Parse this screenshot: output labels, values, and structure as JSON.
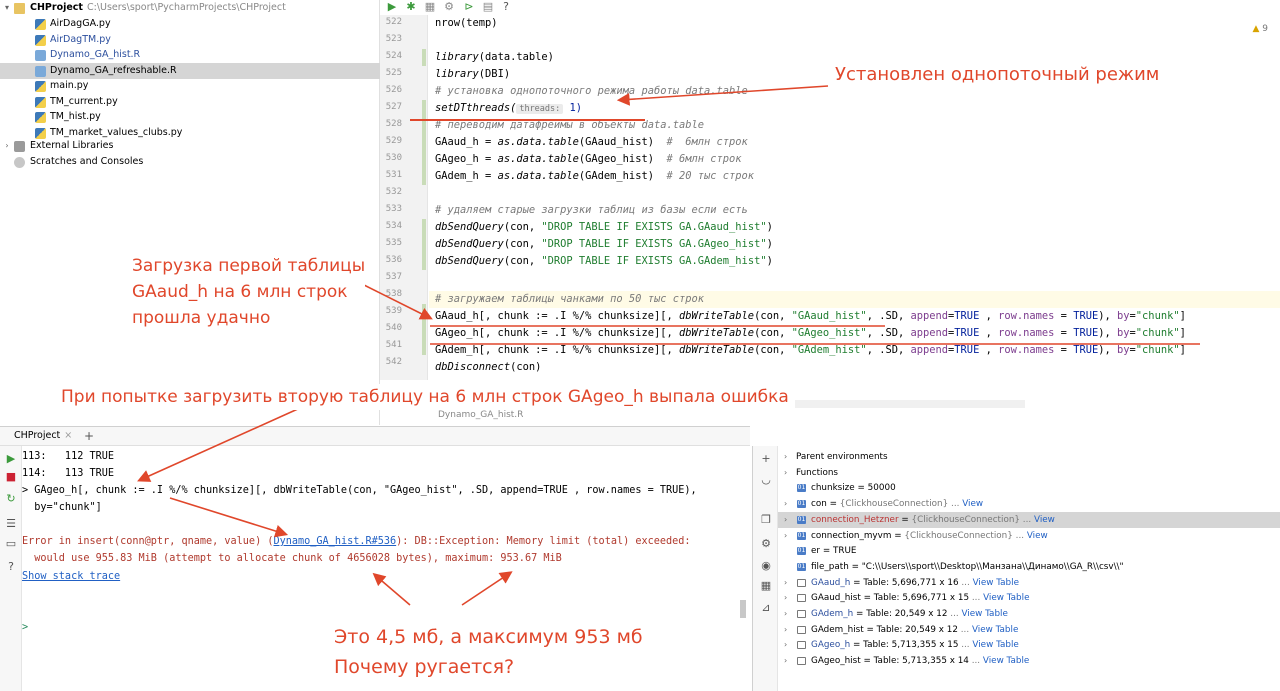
{
  "project_tree": {
    "root_name": "CHProject",
    "root_path": "C:\\Users\\sport\\PycharmProjects\\CHProject",
    "files": [
      {
        "name": "AirDagGA.py",
        "type": "py",
        "color": "#000000"
      },
      {
        "name": "AirDagTM.py",
        "type": "py",
        "color": "#2c4f9e"
      },
      {
        "name": "Dynamo_GA_hist.R",
        "type": "r",
        "color": "#2c4f9e"
      },
      {
        "name": "Dynamo_GA_refreshable.R",
        "type": "r",
        "color": "#000000"
      },
      {
        "name": "main.py",
        "type": "py",
        "color": "#000000"
      },
      {
        "name": "TM_current.py",
        "type": "py",
        "color": "#000000"
      },
      {
        "name": "TM_hist.py",
        "type": "py",
        "color": "#000000"
      },
      {
        "name": "TM_market_values_clubs.py",
        "type": "py",
        "color": "#000000"
      }
    ],
    "external_libraries": "External Libraries",
    "scratches": "Scratches and Consoles"
  },
  "editor": {
    "line_numbers": [
      "522",
      "523",
      "524",
      "525",
      "526",
      "527",
      "528",
      "529",
      "530",
      "531",
      "532",
      "533",
      "534",
      "535",
      "536",
      "537",
      "538",
      "539",
      "540",
      "541",
      "542"
    ],
    "warning_count": "9",
    "tab_label": "Dynamo_GA_hist.R",
    "param_hint": "threads:",
    "lines": {
      "l522": "nrow(temp)",
      "l524a": "library",
      "l524b": "(data.table)",
      "l525a": "library",
      "l525b": "(DBI)",
      "l526": "# установка однопоточного режима работы data.table",
      "l527a": "setDTthreads(",
      "l527b": "1)",
      "l528": "# переводим датафреймы в объекты data.table",
      "l529a": "GAaud_h = ",
      "l529b": "as.data.table",
      "l529c": "(GAaud_hist)  ",
      "l529d": "#  6млн строк",
      "l530a": "GAgeo_h = ",
      "l530b": "as.data.table",
      "l530c": "(GAgeo_hist)  ",
      "l530d": "# 6млн строк",
      "l531a": "GAdem_h = ",
      "l531b": "as.data.table",
      "l531c": "(GAdem_hist)  ",
      "l531d": "# 20 тыс строк",
      "l533": "# удаляем старые загрузки таблиц из базы если есть",
      "l534a": "dbSendQuery",
      "l534b": "(con, ",
      "l534c": "\"DROP TABLE IF EXISTS GA.GAaud_hist\"",
      "l534d": ")",
      "l535a": "dbSendQuery",
      "l535b": "(con, ",
      "l535c": "\"DROP TABLE IF EXISTS GA.GAgeo_hist\"",
      "l535d": ")",
      "l536a": "dbSendQuery",
      "l536b": "(con, ",
      "l536c": "\"DROP TABLE IF EXISTS GA.GAdem_hist\"",
      "l536d": ")",
      "l538": "# загружаем таблицы чанками по 50 тыс строк",
      "l539a": "GAaud_h[, chunk := .I %/% chunksize][, ",
      "l539b": "dbWriteTable",
      "l539c": "(con, ",
      "l539d": "\"GAaud_hist\"",
      "l539e": ", .SD, ",
      "l539f": "append",
      "l539g": "=",
      "l539h": "TRUE",
      "l539i": " , ",
      "l539j": "row.names",
      "l539k": " = ",
      "l539l": "TRUE",
      "l539m": "), ",
      "l539n": "by",
      "l539o": "=",
      "l539p": "\"chunk\"",
      "l539q": "]",
      "l540a": "GAgeo_h[, chunk := .I %/% chunksize][, ",
      "l540b": "dbWriteTable",
      "l540c": "(con, ",
      "l540d": "\"GAgeo_hist\"",
      "l540e": ", .SD, ",
      "l540f": "append",
      "l540g": "=",
      "l540h": "TRUE",
      "l540i": " , ",
      "l540j": "row.names",
      "l540k": " = ",
      "l540l": "TRUE",
      "l540m": "), ",
      "l540n": "by",
      "l540o": "=",
      "l540p": "\"chunk\"",
      "l540q": "]",
      "l541a": "GAdem_h[, chunk := .I %/% chunksize][, ",
      "l541b": "dbWriteTable",
      "l541c": "(con, ",
      "l541d": "\"GAdem_hist\"",
      "l541e": ", .SD, ",
      "l541f": "append",
      "l541g": "=",
      "l541h": "TRUE",
      "l541i": " , ",
      "l541j": "row.names",
      "l541k": " = ",
      "l541l": "TRUE",
      "l541m": "), ",
      "l541n": "by",
      "l541o": "=",
      "l541p": "\"chunk\"",
      "l541q": "]",
      "l542a": "dbDisconnect",
      "l542b": "(con)"
    }
  },
  "annotations": {
    "single_thread": "Установлен однопоточный режим",
    "first_table_1": "Загрузка первой таблицы",
    "first_table_2": "GAaud_h на 6 млн строк",
    "first_table_3": "прошла удачно",
    "second_table_error": "При попытке загрузить вторую таблицу на 6 млн строк GAgeo_h выпала ошибка",
    "question_1": "Это 4,5 мб,  а максимум 953 мб",
    "question_2": "Почему ругается?"
  },
  "console": {
    "tab_label": "CHProject",
    "lines": {
      "c1": "113:   112 TRUE",
      "c2": "114:   113 TRUE",
      "c3": "> GAgeo_h[, chunk := .I %/% chunksize][, dbWriteTable(con, \"GAgeo_hist\", .SD, append=TRUE , row.names = TRUE),",
      "c4": "  by=\"chunk\"]",
      "c5a": "Error in insert(conn@ptr, qname, value) (",
      "c5b": "Dynamo_GA_hist.R#536",
      "c5c": "): DB::Exception: Memory limit (total) exceeded:",
      "c6": "  would use 955.83 MiB (attempt to allocate chunk of 4656028 bytes), maximum: 953.67 MiB",
      "c7": "Show stack trace",
      "c8": ">"
    }
  },
  "variables": [
    {
      "kind": "group",
      "text": "Parent environments"
    },
    {
      "kind": "group",
      "text": "Functions"
    },
    {
      "kind": "value",
      "name": "chunksize",
      "value": " = 50000",
      "type": "",
      "view": ""
    },
    {
      "kind": "obj",
      "name": "con",
      "value": " = ",
      "type": "{ClickhouseConnection}",
      "view": "View"
    },
    {
      "kind": "obj",
      "name": "connection_Hetzner",
      "value": " = ",
      "type": "{ClickhouseConnection}",
      "view": "View",
      "selected": true,
      "red": true
    },
    {
      "kind": "obj",
      "name": "connection_myvm",
      "value": " = ",
      "type": "{ClickhouseConnection}",
      "view": "View"
    },
    {
      "kind": "value",
      "name": "er",
      "value": " = TRUE",
      "type": "",
      "view": ""
    },
    {
      "kind": "value",
      "name": "file_path",
      "value": " = \"C:\\\\Users\\\\sport\\\\Desktop\\\\Манзана\\\\Динамо\\\\GA_R\\\\csv\\\\\"",
      "type": "",
      "view": ""
    },
    {
      "kind": "table",
      "name": "GAaud_h",
      "value": " = Table: 5,696,771 x 16",
      "type": "",
      "view": "View Table",
      "blue": true
    },
    {
      "kind": "table",
      "name": "GAaud_hist",
      "value": " = Table: 5,696,771 x 15",
      "type": "",
      "view": "View Table"
    },
    {
      "kind": "table",
      "name": "GAdem_h",
      "value": " = Table: 20,549 x 12",
      "type": "",
      "view": "View Table",
      "blue": true
    },
    {
      "kind": "table",
      "name": "GAdem_hist",
      "value": " = Table: 20,549 x 12",
      "type": "",
      "view": "View Table"
    },
    {
      "kind": "table",
      "name": "GAgeo_h",
      "value": " = Table: 5,713,355 x 15",
      "type": "",
      "view": "View Table",
      "blue": true
    },
    {
      "kind": "table",
      "name": "GAgeo_hist",
      "value": " = Table: 5,713,355 x 14",
      "type": "",
      "view": "View Table"
    }
  ],
  "colors": {
    "annotation": "#e0472b",
    "selection": "#d5d5d5",
    "link": "#2160c4",
    "error": "#b03a2e"
  }
}
